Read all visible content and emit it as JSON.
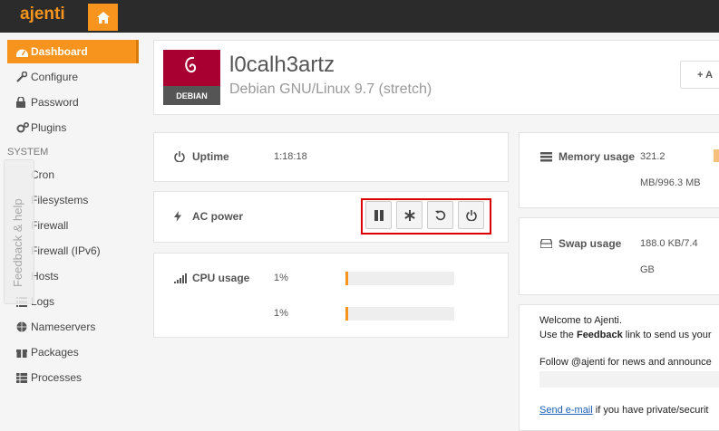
{
  "app": {
    "logo": "ajenti"
  },
  "sidebar": {
    "items": [
      {
        "label": "Dashboard",
        "icon": "dashboard-icon"
      },
      {
        "label": "Configure",
        "icon": "wrench-icon"
      },
      {
        "label": "Password",
        "icon": "lock-icon"
      },
      {
        "label": "Plugins",
        "icon": "cogs-icon"
      }
    ],
    "section": "SYSTEM",
    "system_items": [
      {
        "label": "Cron",
        "icon": "clock-icon"
      },
      {
        "label": "Filesystems",
        "icon": "hdd-icon"
      },
      {
        "label": "Firewall",
        "icon": "shield-icon"
      },
      {
        "label": "Firewall (IPv6)",
        "icon": "shield-icon"
      },
      {
        "label": "Hosts",
        "icon": "server-icon"
      },
      {
        "label": "Logs",
        "icon": "list-icon"
      },
      {
        "label": "Nameservers",
        "icon": "globe-icon"
      },
      {
        "label": "Packages",
        "icon": "gift-icon"
      },
      {
        "label": "Processes",
        "icon": "table-icon"
      }
    ],
    "feedback": "Feedback & help"
  },
  "header": {
    "hostname": "l0calh3artz",
    "os": "Debian GNU/Linux 9.7 (stretch)",
    "os_badge": "DEBIAN",
    "add_label": "+ A"
  },
  "widgets": {
    "uptime": {
      "label": "Uptime",
      "value": "1:18:18"
    },
    "ac_power": {
      "label": "AC power"
    },
    "cpu": {
      "label": "CPU usage",
      "cores": [
        {
          "value": "1%",
          "fraction": 0.01
        },
        {
          "value": "1%",
          "fraction": 0.01
        }
      ]
    },
    "memory": {
      "label": "Memory usage",
      "value_line1": "321.2",
      "value_line2": "MB/996.3 MB"
    },
    "swap": {
      "label": "Swap usage",
      "value_line1": "188.0 KB/7.4",
      "value_line2": "GB"
    }
  },
  "welcome": {
    "line1": "Welcome to Ajenti.",
    "line2_pre": "Use the ",
    "line2_bold": "Feedback",
    "line2_post": " link to send us your",
    "line3": "Follow @ajenti for news and announce",
    "line4_link": "Send e-mail",
    "line4_post": " if you have private/securit"
  },
  "colors": {
    "accent": "#f7941d",
    "topbar": "#2b2b2b",
    "highlight": "#dd0000"
  }
}
